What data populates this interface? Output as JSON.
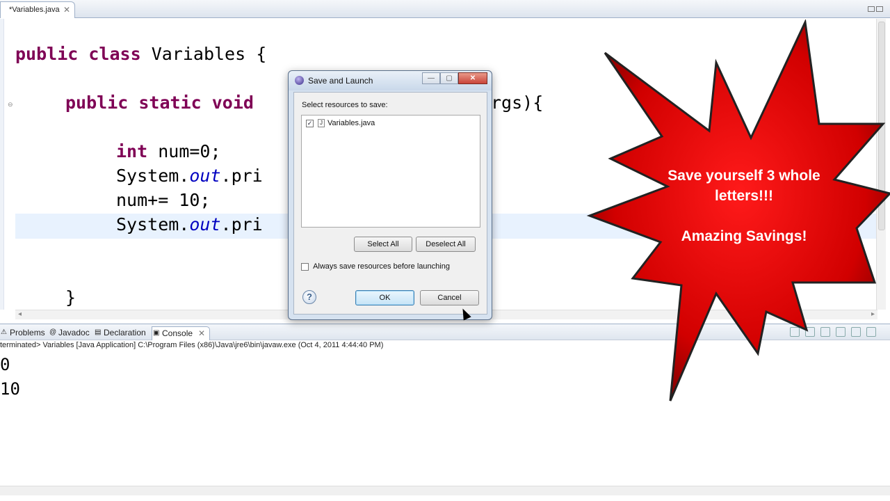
{
  "editor": {
    "tab_label": "*Variables.java",
    "tab_close": "✕",
    "code": {
      "line1_kw1": "public",
      "line1_kw2": "class",
      "line1_rest": "Variables {",
      "line2_kw1": "public",
      "line2_kw2": "static",
      "line2_kw3": "void",
      "line2_rest": "rgs){",
      "line3_kw": "int",
      "line3_rest": "num=0;",
      "line4_a": "System.",
      "line4_b": "out",
      "line4_c": ".pri",
      "line5": "num+= 10;",
      "line6_a": "System.",
      "line6_b": "out",
      "line6_c": ".pri",
      "line7": "}"
    }
  },
  "views": {
    "tabs": [
      {
        "label": "Problems",
        "icon": "⚠"
      },
      {
        "label": "Javadoc",
        "icon": "@"
      },
      {
        "label": "Declaration",
        "icon": "▤"
      },
      {
        "label": "Console",
        "icon": "▣",
        "close": "✕"
      }
    ],
    "console_header": "terminated> Variables [Java Application] C:\\Program Files (x86)\\Java\\jre6\\bin\\javaw.exe (Oct 4, 2011 4:44:40 PM)",
    "console_lines": [
      "0",
      "10"
    ]
  },
  "dialog": {
    "title": "Save and Launch",
    "min_glyph": "—",
    "max_glyph": "▢",
    "close_glyph": "✕",
    "select_label": "Select resources to save:",
    "resources": [
      {
        "name": "Variables.java",
        "checked": true,
        "check_glyph": "✓",
        "file_glyph": "J"
      }
    ],
    "select_all": "Select All",
    "deselect_all": "Deselect All",
    "always_save_label": "Always save resources before launching",
    "always_save_checked": false,
    "help_glyph": "?",
    "ok": "OK",
    "cancel": "Cancel"
  },
  "callout": {
    "line1": "Save yourself 3 whole letters!!!",
    "line2": "Amazing Savings!",
    "color": "#d10000"
  }
}
